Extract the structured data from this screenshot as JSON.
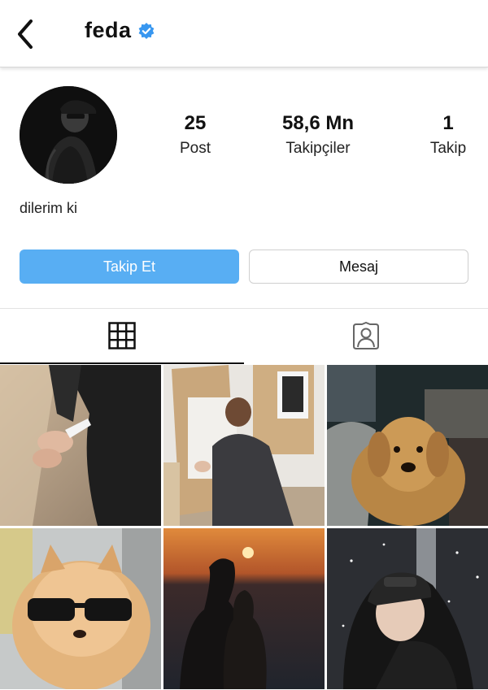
{
  "header": {
    "back_icon": "chevron-left-icon",
    "username": "feda",
    "verified_icon": "verified-badge-icon",
    "accent": "#3897f0"
  },
  "profile": {
    "stats": [
      {
        "value": "25",
        "label": "Post"
      },
      {
        "value": "58,6 Mn",
        "label": "Takipçiler"
      },
      {
        "value": "1",
        "label": "Takip"
      }
    ],
    "bio": "dilerim ki"
  },
  "actions": {
    "follow_label": "Takip Et",
    "follow_color": "#58aef3",
    "message_label": "Mesaj"
  },
  "tabs": [
    {
      "icon": "grid-icon",
      "active": true
    },
    {
      "icon": "tagged-user-icon",
      "active": false
    }
  ],
  "posts": [
    {
      "subject": "holding-hands-photo"
    },
    {
      "subject": "drawing-class-photo"
    },
    {
      "subject": "golden-retriever-photo"
    },
    {
      "subject": "pomeranian-sunglasses-photo"
    },
    {
      "subject": "sunset-couple-photo"
    },
    {
      "subject": "snow-selfie-photo"
    }
  ]
}
